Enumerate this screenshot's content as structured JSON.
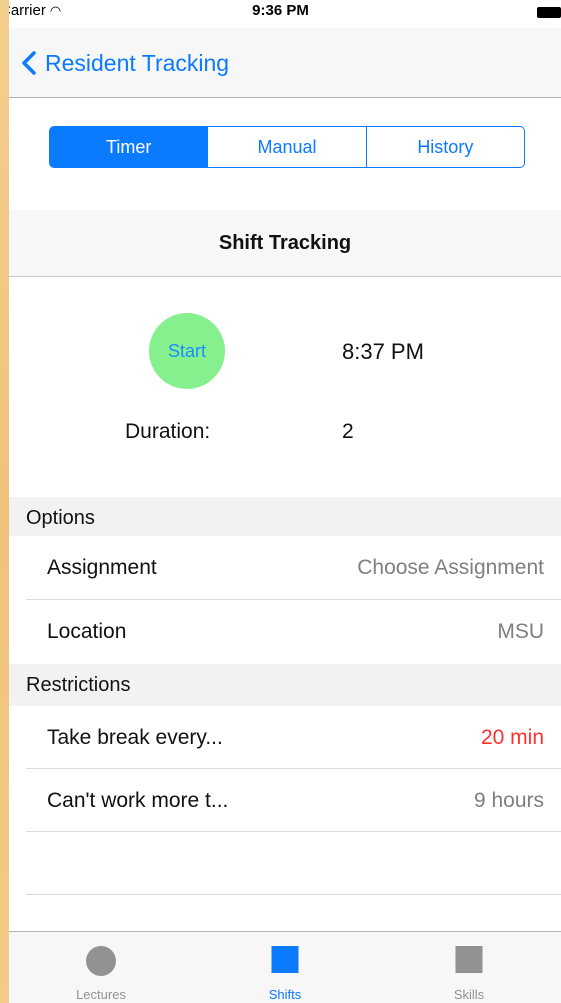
{
  "status_bar": {
    "carrier": "Carrier",
    "time": "9:36 PM"
  },
  "nav": {
    "back_label": "Resident Tracking"
  },
  "segments": [
    "Timer",
    "Manual",
    "History"
  ],
  "section_title": "Shift Tracking",
  "timer": {
    "start_label": "Start",
    "start_time": "8:37 PM",
    "duration_label": "Duration:",
    "duration_value": "2"
  },
  "options": {
    "header": "Options",
    "rows": [
      {
        "label": "Assignment",
        "value": "Choose Assignment"
      },
      {
        "label": "Location",
        "value": "MSU"
      }
    ]
  },
  "restrictions": {
    "header": "Restrictions",
    "rows": [
      {
        "label": "Take break every...",
        "value": "20 min",
        "value_color": "#ff2f2f"
      },
      {
        "label": "Can't work more t...",
        "value": "9 hours"
      }
    ]
  },
  "tabs": [
    {
      "label": "Lectures",
      "icon": "circle-icon"
    },
    {
      "label": "Shifts",
      "icon": "square-icon",
      "active": true
    },
    {
      "label": "Skills",
      "icon": "square-icon"
    }
  ],
  "colors": {
    "accent": "#0a7aff",
    "start_button": "#87f08e",
    "alert": "#ff2f2f"
  }
}
